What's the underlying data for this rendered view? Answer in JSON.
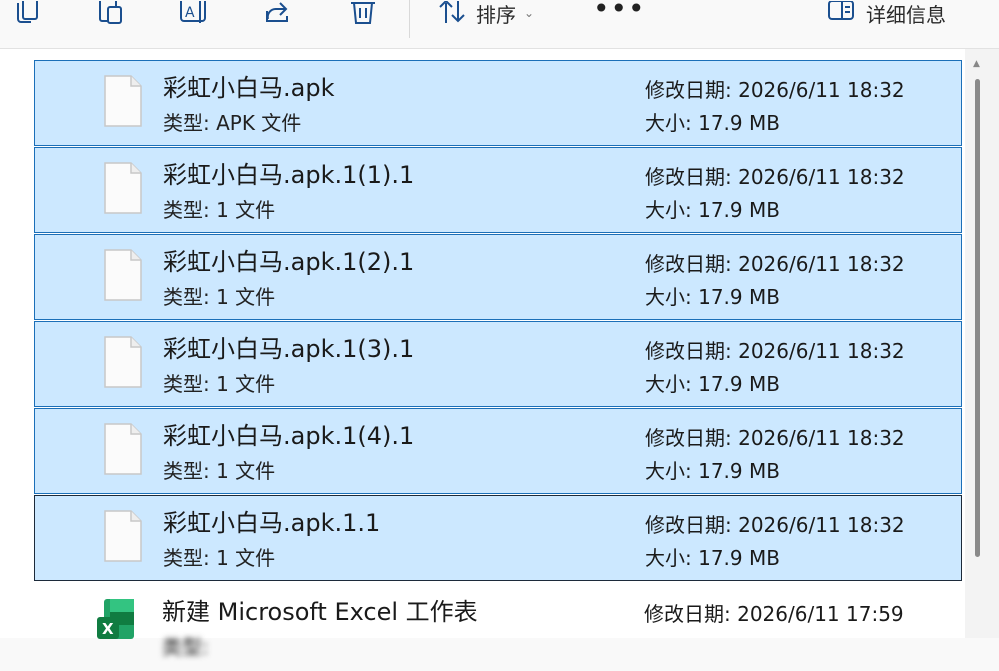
{
  "toolbar": {
    "sort_label": "排序",
    "sort_chevron": "⌄",
    "more_label": "•••",
    "details_label": "详细信息",
    "icons": [
      "copy-icon",
      "paste-icon",
      "rename-icon",
      "share-icon",
      "delete-icon",
      "sort-icon",
      "details-pane-icon"
    ]
  },
  "files": [
    {
      "name": "彩虹小白马.apk",
      "type": "类型: APK 文件",
      "modified": "修改日期: 2026/6/11 18:32",
      "size": "大小: 17.9 MB",
      "selected": true
    },
    {
      "name": "彩虹小白马.apk.1(1).1",
      "type": "类型: 1 文件",
      "modified": "修改日期: 2026/6/11 18:32",
      "size": "大小: 17.9 MB",
      "selected": true
    },
    {
      "name": "彩虹小白马.apk.1(2).1",
      "type": "类型: 1 文件",
      "modified": "修改日期: 2026/6/11 18:32",
      "size": "大小: 17.9 MB",
      "selected": true
    },
    {
      "name": "彩虹小白马.apk.1(3).1",
      "type": "类型: 1 文件",
      "modified": "修改日期: 2026/6/11 18:32",
      "size": "大小: 17.9 MB",
      "selected": true
    },
    {
      "name": "彩虹小白马.apk.1(4).1",
      "type": "类型: 1 文件",
      "modified": "修改日期: 2026/6/11 18:32",
      "size": "大小: 17.9 MB",
      "selected": true
    },
    {
      "name": "彩虹小白马.apk.1.1",
      "type": "类型: 1 文件",
      "modified": "修改日期: 2026/6/11 18:32",
      "size": "大小: 17.9 MB",
      "selected": true
    },
    {
      "name": "新建 Microsoft Excel 工作表",
      "type": "类型: ",
      "modified": "修改日期: 2026/6/11 17:59",
      "size": "",
      "selected": false
    }
  ],
  "colors": {
    "selection_bg": "#cce8ff",
    "selection_border": "#1b6fb8",
    "toolbar_icon": "#1b4f8f"
  }
}
